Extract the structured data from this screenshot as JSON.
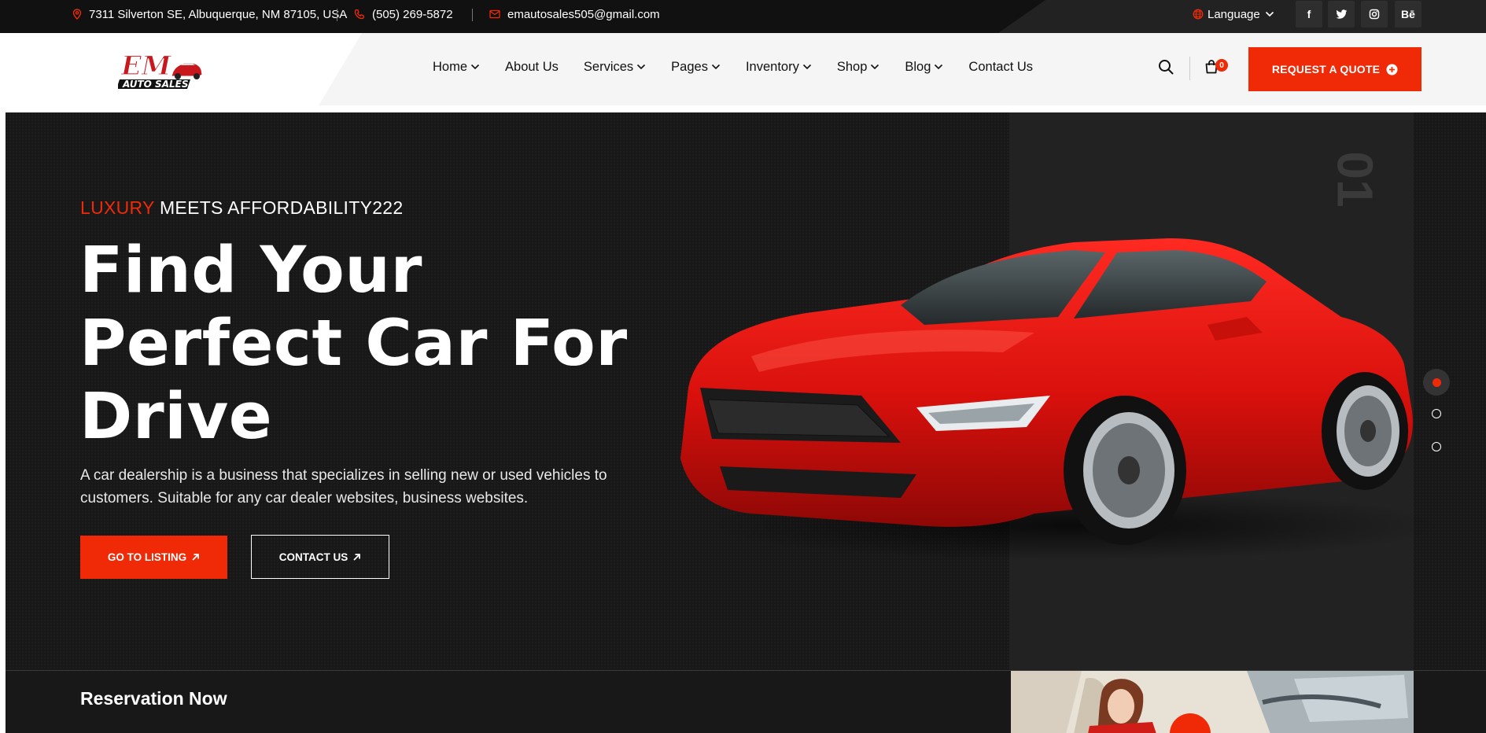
{
  "topbar": {
    "address": "7311 Silverton SE, Albuquerque, NM 87105, USA",
    "phone": "(505) 269-5872",
    "email": "emautosales505@gmail.com",
    "language_label": "Language",
    "social": [
      {
        "name": "facebook",
        "glyph": "f"
      },
      {
        "name": "twitter",
        "glyph": ""
      },
      {
        "name": "instagram",
        "glyph": ""
      },
      {
        "name": "behance",
        "glyph": "Bē"
      }
    ]
  },
  "header": {
    "logo_line1": "EM",
    "logo_line2": "AUTO SALES",
    "nav": [
      {
        "label": "Home",
        "dropdown": true
      },
      {
        "label": "About Us",
        "dropdown": false
      },
      {
        "label": "Services",
        "dropdown": true
      },
      {
        "label": "Pages",
        "dropdown": true
      },
      {
        "label": "Inventory",
        "dropdown": true
      },
      {
        "label": "Shop",
        "dropdown": true
      },
      {
        "label": "Blog",
        "dropdown": true
      },
      {
        "label": "Contact Us",
        "dropdown": false
      }
    ],
    "cart_count": "0",
    "quote_label": "REQUEST A QUOTE"
  },
  "hero": {
    "tagline_accent": "LUXURY",
    "tagline_rest": " MEETS AFFORDABILITY222",
    "title_line1": "Find Your",
    "title_line2": "Perfect Car For",
    "title_line3": "Drive",
    "description": "A car dealership is a business that specializes in selling new or used vehicles to customers. Suitable for any car dealer websites, business websites.",
    "btn_listing": "GO TO LISTING",
    "btn_contact": "CONTACT US",
    "slide_number": "01",
    "active_slide": 1,
    "slide_count": 3
  },
  "reservation": {
    "title": "Reservation Now"
  },
  "colors": {
    "accent": "#f02a07",
    "dark": "#181818",
    "panel": "#222222"
  }
}
